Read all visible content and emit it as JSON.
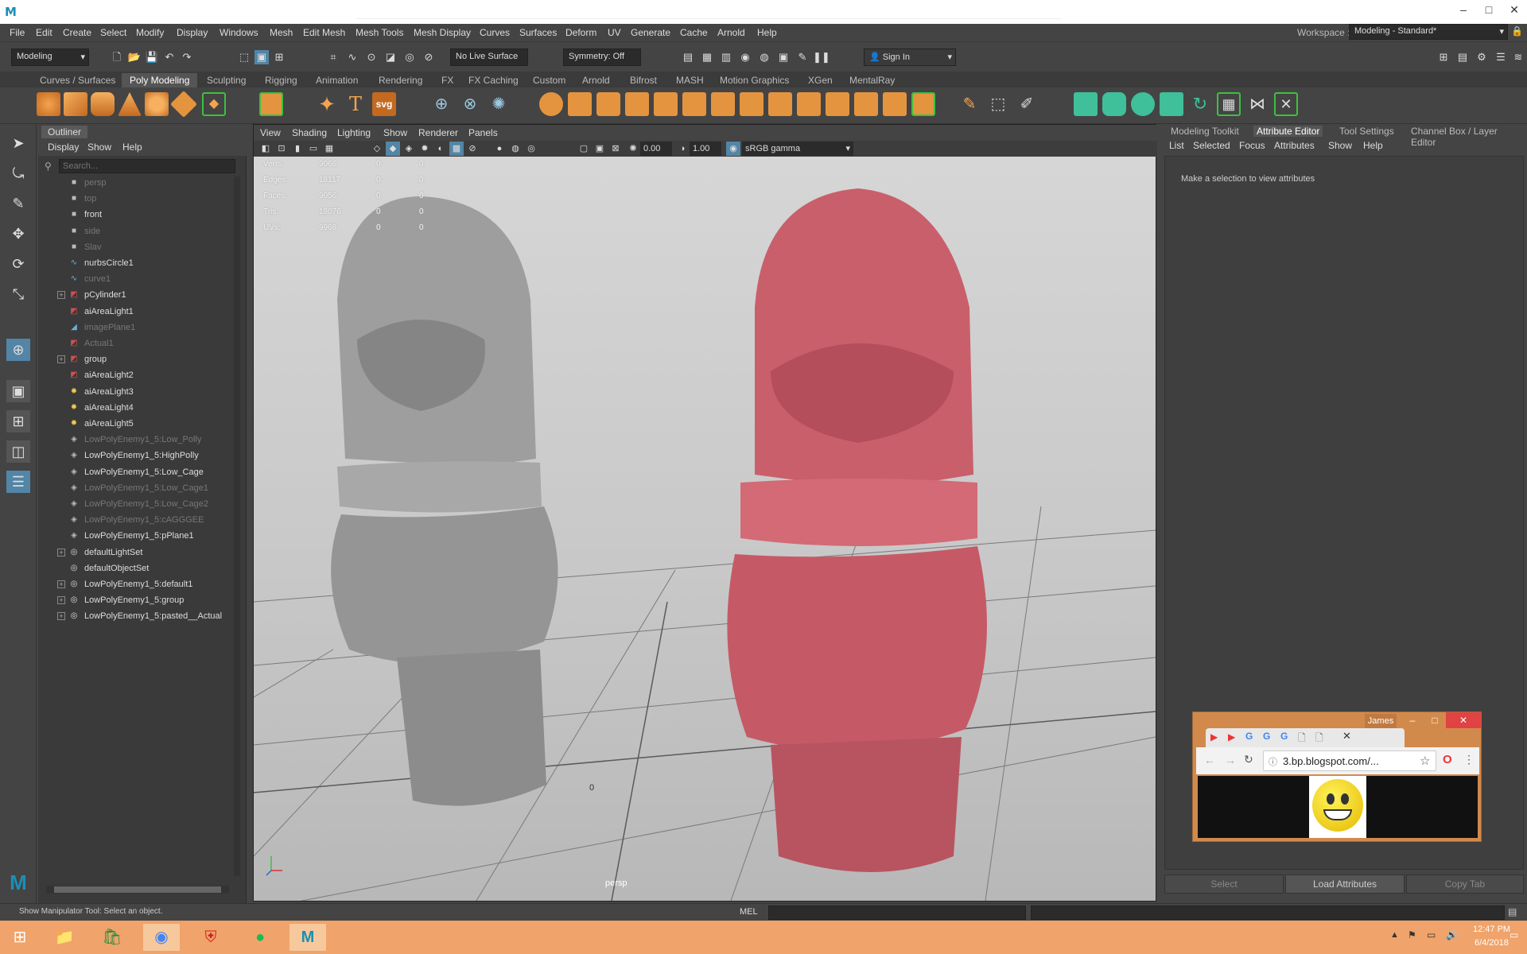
{
  "window": {
    "app_logo": "M",
    "controls": {
      "minimize": "–",
      "maximize": "□",
      "close": "✕"
    }
  },
  "menubar": [
    "File",
    "Edit",
    "Create",
    "Select",
    "Modify",
    "Display",
    "Windows",
    "Mesh",
    "Edit Mesh",
    "Mesh Tools",
    "Mesh Display",
    "Curves",
    "Surfaces",
    "Deform",
    "UV",
    "Generate",
    "Cache",
    "Arnold",
    "Help"
  ],
  "workspace": {
    "label": "Workspace :",
    "value": "Modeling - Standard*"
  },
  "statusline": {
    "mode": "Modeling",
    "live_surface": "No Live Surface",
    "symmetry": "Symmetry: Off",
    "sign_in": "Sign In"
  },
  "shelf_tabs": [
    "Curves / Surfaces",
    "Poly Modeling",
    "Sculpting",
    "Rigging",
    "Animation",
    "Rendering",
    "FX",
    "FX Caching",
    "Custom",
    "Arnold",
    "Bifrost",
    "MASH",
    "Motion Graphics",
    "XGen",
    "MentalRay"
  ],
  "shelf_active": "Poly Modeling",
  "shelf_text_icons": {
    "type": "T",
    "svg": "svg"
  },
  "outliner": {
    "tab": "Outliner",
    "menu": [
      "Display",
      "Show",
      "Help"
    ],
    "search_placeholder": "Search...",
    "items": [
      {
        "label": "persp",
        "dim": true,
        "exp": false,
        "icon": "camera-icon"
      },
      {
        "label": "top",
        "dim": true,
        "exp": false,
        "icon": "camera-icon"
      },
      {
        "label": "front",
        "dim": false,
        "exp": false,
        "icon": "camera-icon"
      },
      {
        "label": "side",
        "dim": true,
        "exp": false,
        "icon": "camera-icon"
      },
      {
        "label": "Slav",
        "dim": true,
        "exp": false,
        "icon": "camera-icon"
      },
      {
        "label": "nurbsCircle1",
        "dim": false,
        "exp": false,
        "icon": "curve-icon"
      },
      {
        "label": "curve1",
        "dim": true,
        "exp": false,
        "icon": "curve-icon"
      },
      {
        "label": "pCylinder1",
        "dim": false,
        "exp": true,
        "icon": "mesh-icon"
      },
      {
        "label": "aiAreaLight1",
        "dim": false,
        "exp": false,
        "icon": "mesh-icon"
      },
      {
        "label": "imagePlane1",
        "dim": true,
        "exp": false,
        "icon": "image-plane-icon"
      },
      {
        "label": "Actual1",
        "dim": true,
        "exp": false,
        "icon": "mesh-icon"
      },
      {
        "label": "group",
        "dim": false,
        "exp": true,
        "icon": "mesh-icon"
      },
      {
        "label": "aiAreaLight2",
        "dim": false,
        "exp": false,
        "icon": "mesh-icon"
      },
      {
        "label": "aiAreaLight3",
        "dim": false,
        "exp": false,
        "icon": "light-icon"
      },
      {
        "label": "aiAreaLight4",
        "dim": false,
        "exp": false,
        "icon": "light-icon"
      },
      {
        "label": "aiAreaLight5",
        "dim": false,
        "exp": false,
        "icon": "light-icon"
      },
      {
        "label": "LowPolyEnemy1_5:Low_Polly",
        "dim": true,
        "exp": false,
        "icon": "polymesh-icon"
      },
      {
        "label": "LowPolyEnemy1_5:HighPolly",
        "dim": false,
        "exp": false,
        "icon": "polymesh-icon"
      },
      {
        "label": "LowPolyEnemy1_5:Low_Cage",
        "dim": false,
        "exp": false,
        "icon": "polymesh-icon"
      },
      {
        "label": "LowPolyEnemy1_5:Low_Cage1",
        "dim": true,
        "exp": false,
        "icon": "polymesh-icon"
      },
      {
        "label": "LowPolyEnemy1_5:Low_Cage2",
        "dim": true,
        "exp": false,
        "icon": "polymesh-icon"
      },
      {
        "label": "LowPolyEnemy1_5:cAGGGEE",
        "dim": true,
        "exp": false,
        "icon": "polymesh-icon"
      },
      {
        "label": "LowPolyEnemy1_5:pPlane1",
        "dim": false,
        "exp": false,
        "icon": "polymesh-icon"
      },
      {
        "label": "defaultLightSet",
        "dim": false,
        "exp": true,
        "icon": "set-icon"
      },
      {
        "label": "defaultObjectSet",
        "dim": false,
        "exp": false,
        "icon": "set-icon"
      },
      {
        "label": "LowPolyEnemy1_5:default1",
        "dim": false,
        "exp": true,
        "icon": "set-icon"
      },
      {
        "label": "LowPolyEnemy1_5:group",
        "dim": false,
        "exp": true,
        "icon": "set-icon"
      },
      {
        "label": "LowPolyEnemy1_5:pasted__Actual",
        "dim": false,
        "exp": true,
        "icon": "set-icon"
      }
    ]
  },
  "viewport": {
    "menu": [
      "View",
      "Shading",
      "Lighting",
      "Show",
      "Renderer",
      "Panels"
    ],
    "exposure": "0.00",
    "gamma": "1.00",
    "color_space": "sRGB gamma",
    "camera": "persp",
    "origin_label": "0",
    "hud": [
      {
        "label": "Verts:",
        "v": "9066",
        "a": "0",
        "b": "0"
      },
      {
        "label": "Edges:",
        "v": "18117",
        "a": "0",
        "b": "0"
      },
      {
        "label": "Faces:",
        "v": "9056",
        "a": "0",
        "b": "0"
      },
      {
        "label": "Tris:",
        "v": "18076",
        "a": "0",
        "b": "0"
      },
      {
        "label": "UVs:",
        "v": "9968",
        "a": "0",
        "b": "0"
      }
    ],
    "model_colors": {
      "left": "#9a9a9a",
      "right": "#c55a66"
    }
  },
  "right_panel": {
    "tabs": [
      "Modeling Toolkit",
      "Attribute Editor",
      "Tool Settings",
      "Channel Box / Layer Editor"
    ],
    "active_tab": "Attribute Editor",
    "menu": [
      "List",
      "Selected",
      "Focus",
      "Attributes",
      "Show",
      "Help"
    ],
    "message": "Make a selection to view attributes",
    "buttons": [
      "Select",
      "Load Attributes",
      "Copy Tab"
    ]
  },
  "chrome_popup": {
    "profile": "James",
    "url": "3.bp.blogspot.com/..."
  },
  "command_line": {
    "help": "Show Manipulator Tool: Select an object.",
    "lang": "MEL"
  },
  "taskbar": {
    "time": "12:47 PM",
    "date": "6/4/2018"
  },
  "colors": {
    "accent": "#5285a6",
    "maya_bg": "#444444",
    "taskbar": "#f0a36a"
  }
}
